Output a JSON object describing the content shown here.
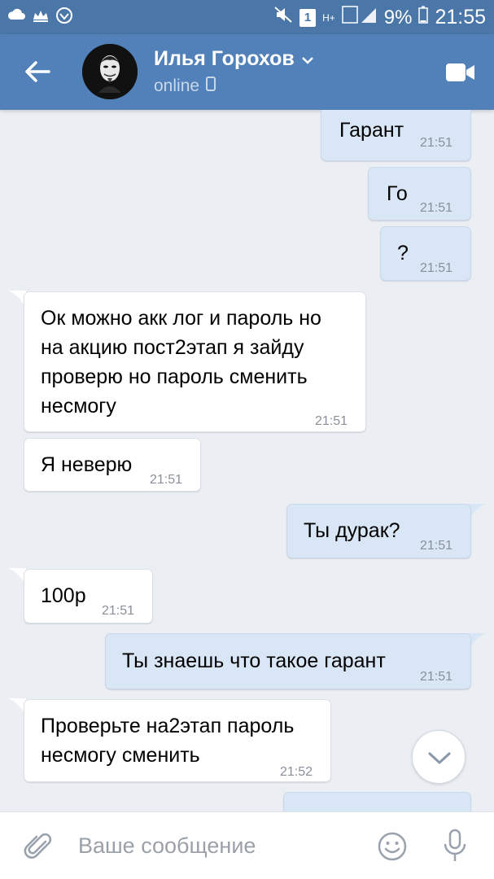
{
  "status_bar": {
    "battery": "9%",
    "time": "21:55",
    "sim": "1",
    "network": "H+"
  },
  "header": {
    "contact_name": "Илья Горохов",
    "status": "online"
  },
  "messages": [
    {
      "dir": "out",
      "text": "Гарант",
      "time": "21:51"
    },
    {
      "dir": "out",
      "text": "Го",
      "time": "21:51"
    },
    {
      "dir": "out",
      "text": "?",
      "time": "21:51"
    },
    {
      "dir": "in",
      "lines": [
        "Ок можно акк лог и пароль но",
        "на акцию пост2этап я зайду",
        "проверю но пароль сменить",
        "несмогу"
      ],
      "time": "21:51"
    },
    {
      "dir": "in",
      "text": "Я неверю",
      "time": "21:51"
    },
    {
      "dir": "out",
      "text": "Ты дурак?",
      "time": "21:51"
    },
    {
      "dir": "in",
      "text": "100р",
      "time": "21:51"
    },
    {
      "dir": "out",
      "text": "Ты знаешь что такое гарант",
      "time": "21:51"
    },
    {
      "dir": "in",
      "lines": [
        "Проверьте на2этап пароль",
        "несмогу сменить"
      ],
      "time": "21:52"
    }
  ],
  "composer": {
    "placeholder": "Ваше сообщение"
  },
  "colors": {
    "status_bar": "#4a76a8",
    "header": "#5181b8",
    "chat_bg": "#ebeff4",
    "outgoing_bubble": "#d9e6f5",
    "incoming_bubble": "#ffffff"
  }
}
